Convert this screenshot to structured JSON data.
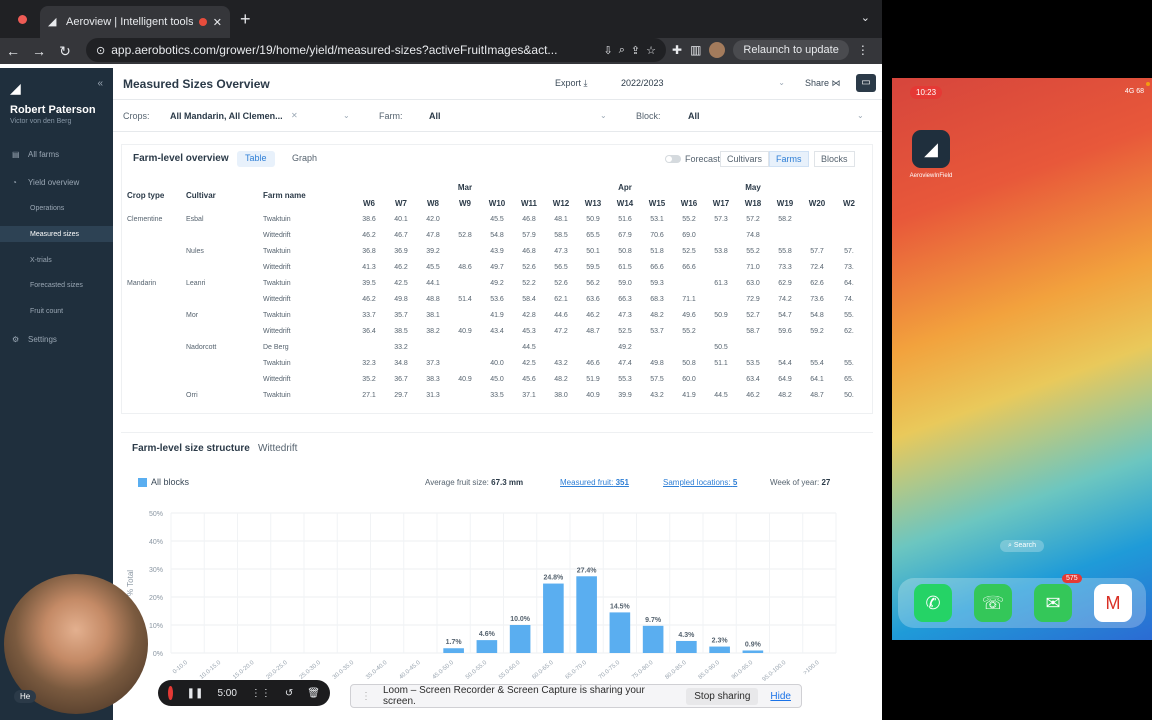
{
  "browser": {
    "tab_title": "Aeroview | Intelligent tools",
    "url": "app.aerobotics.com/grower/19/home/yield/measured-sizes?activeFruitImages&act...",
    "relaunch_label": "Relaunch to update"
  },
  "sidebar": {
    "user_name": "Robert Paterson",
    "user_sub": "Victor von den Berg",
    "items": [
      {
        "label": "All farms"
      },
      {
        "label": "Yield overview"
      },
      {
        "label": "Operations"
      },
      {
        "label": "Measured sizes"
      },
      {
        "label": "X-trials"
      },
      {
        "label": "Forecasted sizes"
      },
      {
        "label": "Fruit count"
      },
      {
        "label": "Settings"
      }
    ]
  },
  "header": {
    "title": "Measured Sizes Overview",
    "export_label": "Export",
    "season": "2022/2023",
    "share_label": "Share"
  },
  "filters": {
    "crops_label": "Crops:",
    "crops_value": "All Mandarin, All Clemen...",
    "farm_label": "Farm:",
    "farm_value": "All",
    "block_label": "Block:",
    "block_value": "All"
  },
  "overview": {
    "title": "Farm-level overview",
    "table_label": "Table",
    "graph_label": "Graph",
    "forecast_label": "Forecast",
    "cultivars_label": "Cultivars",
    "farms_label": "Farms",
    "blocks_label": "Blocks",
    "col_crop": "Crop type",
    "col_cultivar": "Cultivar",
    "col_farm": "Farm name",
    "months": [
      {
        "label": "Mar",
        "col": 3
      },
      {
        "label": "Apr",
        "col": 8
      },
      {
        "label": "May",
        "col": 12
      }
    ],
    "weeks": [
      "W6",
      "W7",
      "W8",
      "W9",
      "W10",
      "W11",
      "W12",
      "W13",
      "W14",
      "W15",
      "W16",
      "W17",
      "W18",
      "W19",
      "W20",
      "W2"
    ],
    "rows": [
      {
        "crop": "Clementine",
        "cultivar": "Esbal",
        "farm": "Twaktuin",
        "v": [
          "38.6",
          "40.1",
          "42.0",
          "",
          "45.5",
          "46.8",
          "48.1",
          "50.9",
          "51.6",
          "53.1",
          "55.2",
          "57.3",
          "57.2",
          "58.2",
          "",
          ""
        ]
      },
      {
        "crop": "",
        "cultivar": "",
        "farm": "Wittedrift",
        "v": [
          "46.2",
          "46.7",
          "47.8",
          "52.8",
          "54.8",
          "57.9",
          "58.5",
          "65.5",
          "67.9",
          "70.6",
          "69.0",
          "",
          "74.8",
          "",
          "",
          ""
        ]
      },
      {
        "crop": "",
        "cultivar": "Nules",
        "farm": "Twaktuin",
        "v": [
          "36.8",
          "36.9",
          "39.2",
          "",
          "43.9",
          "46.8",
          "47.3",
          "50.1",
          "50.8",
          "51.8",
          "52.5",
          "53.8",
          "55.2",
          "55.8",
          "57.7",
          "57."
        ]
      },
      {
        "crop": "",
        "cultivar": "",
        "farm": "Wittedrift",
        "v": [
          "41.3",
          "46.2",
          "45.5",
          "48.6",
          "49.7",
          "52.6",
          "56.5",
          "59.5",
          "61.5",
          "66.6",
          "66.6",
          "",
          "71.0",
          "73.3",
          "72.4",
          "73."
        ]
      },
      {
        "crop": "Mandarin",
        "cultivar": "Leanri",
        "farm": "Twaktuin",
        "v": [
          "39.5",
          "42.5",
          "44.1",
          "",
          "49.2",
          "52.2",
          "52.6",
          "56.2",
          "59.0",
          "59.3",
          "",
          "61.3",
          "63.0",
          "62.9",
          "62.6",
          "64."
        ]
      },
      {
        "crop": "",
        "cultivar": "",
        "farm": "Wittedrift",
        "v": [
          "46.2",
          "49.8",
          "48.8",
          "51.4",
          "53.6",
          "58.4",
          "62.1",
          "63.6",
          "66.3",
          "68.3",
          "71.1",
          "",
          "72.9",
          "74.2",
          "73.6",
          "74."
        ]
      },
      {
        "crop": "",
        "cultivar": "Mor",
        "farm": "Twaktuin",
        "v": [
          "33.7",
          "35.7",
          "38.1",
          "",
          "41.9",
          "42.8",
          "44.6",
          "46.2",
          "47.3",
          "48.2",
          "49.6",
          "50.9",
          "52.7",
          "54.7",
          "54.8",
          "55."
        ]
      },
      {
        "crop": "",
        "cultivar": "",
        "farm": "Wittedrift",
        "v": [
          "36.4",
          "38.5",
          "38.2",
          "40.9",
          "43.4",
          "45.3",
          "47.2",
          "48.7",
          "52.5",
          "53.7",
          "55.2",
          "",
          "58.7",
          "59.6",
          "59.2",
          "62."
        ]
      },
      {
        "crop": "",
        "cultivar": "Nadorcott",
        "farm": "De Berg",
        "v": [
          "",
          "33.2",
          "",
          "",
          "",
          "44.5",
          "",
          "",
          "49.2",
          "",
          "",
          "50.5",
          "",
          "",
          "",
          ""
        ]
      },
      {
        "crop": "",
        "cultivar": "",
        "farm": "Twaktuin",
        "v": [
          "32.3",
          "34.8",
          "37.3",
          "",
          "40.0",
          "42.5",
          "43.2",
          "46.6",
          "47.4",
          "49.8",
          "50.8",
          "51.1",
          "53.5",
          "54.4",
          "55.4",
          "55."
        ]
      },
      {
        "crop": "",
        "cultivar": "",
        "farm": "Wittedrift",
        "v": [
          "35.2",
          "36.7",
          "38.3",
          "40.9",
          "45.0",
          "45.6",
          "48.2",
          "51.9",
          "55.3",
          "57.5",
          "60.0",
          "",
          "63.4",
          "64.9",
          "64.1",
          "65."
        ]
      },
      {
        "crop": "",
        "cultivar": "Orri",
        "farm": "Twaktuin",
        "v": [
          "27.1",
          "29.7",
          "31.3",
          "",
          "33.5",
          "37.1",
          "38.0",
          "40.9",
          "39.9",
          "43.2",
          "41.9",
          "44.5",
          "46.2",
          "48.2",
          "48.7",
          "50."
        ]
      }
    ]
  },
  "structure": {
    "title": "Farm-level size structure",
    "subtitle": "Wittedrift",
    "legend_label": "All blocks",
    "avg_label": "Average fruit size:",
    "avg_value": "67.3 mm",
    "measured_label": "Measured fruit:",
    "measured_value": "351",
    "sampled_label": "Sampled locations:",
    "sampled_value": "5",
    "week_label": "Week of year:",
    "week_value": "27"
  },
  "chart_data": {
    "type": "bar",
    "ylabel": "% Total",
    "ylim": [
      0,
      50
    ],
    "yticks": [
      "0%",
      "10%",
      "20%",
      "30%",
      "40%",
      "50%"
    ],
    "categories": [
      "0-10.0",
      "10.0-15.0",
      "15.0-20.0",
      "20.0-25.0",
      "25.0-30.0",
      "30.0-35.0",
      "35.0-40.0",
      "40.0-45.0",
      "45.0-50.0",
      "50.0-55.0",
      "55.0-60.0",
      "60.0-65.0",
      "65.0-70.0",
      "70.0-75.0",
      "75.0-80.0",
      "80.0-85.0",
      "85.0-90.0",
      "90.0-95.0",
      "95.0-100.0",
      ">100.0"
    ],
    "values": [
      0,
      0,
      0,
      0,
      0,
      0,
      0,
      0,
      1.7,
      4.6,
      10.0,
      24.8,
      27.4,
      14.5,
      9.7,
      4.3,
      2.3,
      0.9,
      0,
      0
    ],
    "labels": [
      "",
      "",
      "",
      "",
      "",
      "",
      "",
      "",
      "1.7%",
      "4.6%",
      "10.0%",
      "24.8%",
      "27.4%",
      "14.5%",
      "9.7%",
      "4.3%",
      "2.3%",
      "0.9%",
      "",
      ""
    ],
    "color": "#5aaef0"
  },
  "phone": {
    "time": "10:23",
    "status": "4G 68",
    "app_label": "AeroviewInField",
    "search_label": "Search",
    "badge": "575"
  },
  "loom": {
    "timer": "5:00",
    "message": "Loom – Screen Recorder & Screen Capture is sharing your screen.",
    "stop_label": "Stop sharing",
    "hide_label": "Hide",
    "help_label": "He"
  }
}
